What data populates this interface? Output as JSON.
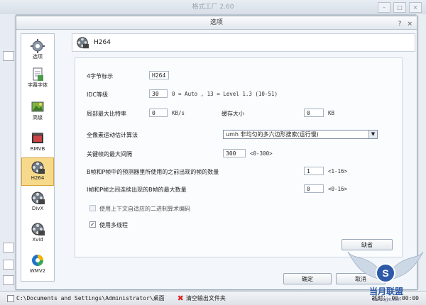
{
  "app": {
    "title": "格式工厂 2.60"
  },
  "dialog": {
    "title": "选项",
    "help": "?",
    "close": "×"
  },
  "sidebar": {
    "items": [
      {
        "label": "选项",
        "icon": "gear-icon"
      },
      {
        "label": "字幕字体",
        "icon": "document-icon"
      },
      {
        "label": "高级",
        "icon": "image-icon"
      },
      {
        "label": "RMVB",
        "icon": "film-icon"
      },
      {
        "label": "H264",
        "icon": "film-reel-icon"
      },
      {
        "label": "DivX",
        "icon": "film-reel-icon"
      },
      {
        "label": "Xvid",
        "icon": "film-reel-icon"
      },
      {
        "label": "WMV2",
        "icon": "wmv-icon"
      }
    ]
  },
  "header": {
    "title": "H264"
  },
  "form": {
    "fourcc_label": "4字节标示",
    "fourcc_value": "H264",
    "idc_label": "IDC等级",
    "idc_value": "30",
    "idc_hint": "0 = Auto , 13 = Level 1.3 (10-51)",
    "bitrate_label": "局部最大比特率",
    "bitrate_value": "0",
    "bitrate_unit": "KB/s",
    "buffer_label": "缓存大小",
    "buffer_value": "0",
    "buffer_unit": "KB",
    "motion_label": "全像素运动估计算法",
    "motion_value": "umh   非均匀的多六边形搜索(运行慢)",
    "keyint_label": "关键帧的最大间隔",
    "keyint_value": "300",
    "keyint_hint": "<0-300>",
    "ref_label": "B帧和P帧中的预测器里所使用的之前出现的帧的数量",
    "ref_value": "1",
    "ref_hint": "<1-16>",
    "bframes_label": "I帧和P帧之间连续出现的B帧的最大数量",
    "bframes_value": "0",
    "bframes_hint": "<0-16>",
    "cabac_label": "使用上下文自适应的二进制算术编码",
    "threads_label": "使用多线程",
    "threads_checked": "✓"
  },
  "buttons": {
    "default": "缺省",
    "ok": "确定",
    "cancel": "取消"
  },
  "status": {
    "path": "C:\\Documents and Settings\\Administrator\\桌面",
    "clear": "清空输出文件夹",
    "time_label": "耗时：",
    "time_value": "00:00:00"
  },
  "watermark": {
    "text": "当月联盟",
    "url": "www.dyjm.com"
  }
}
